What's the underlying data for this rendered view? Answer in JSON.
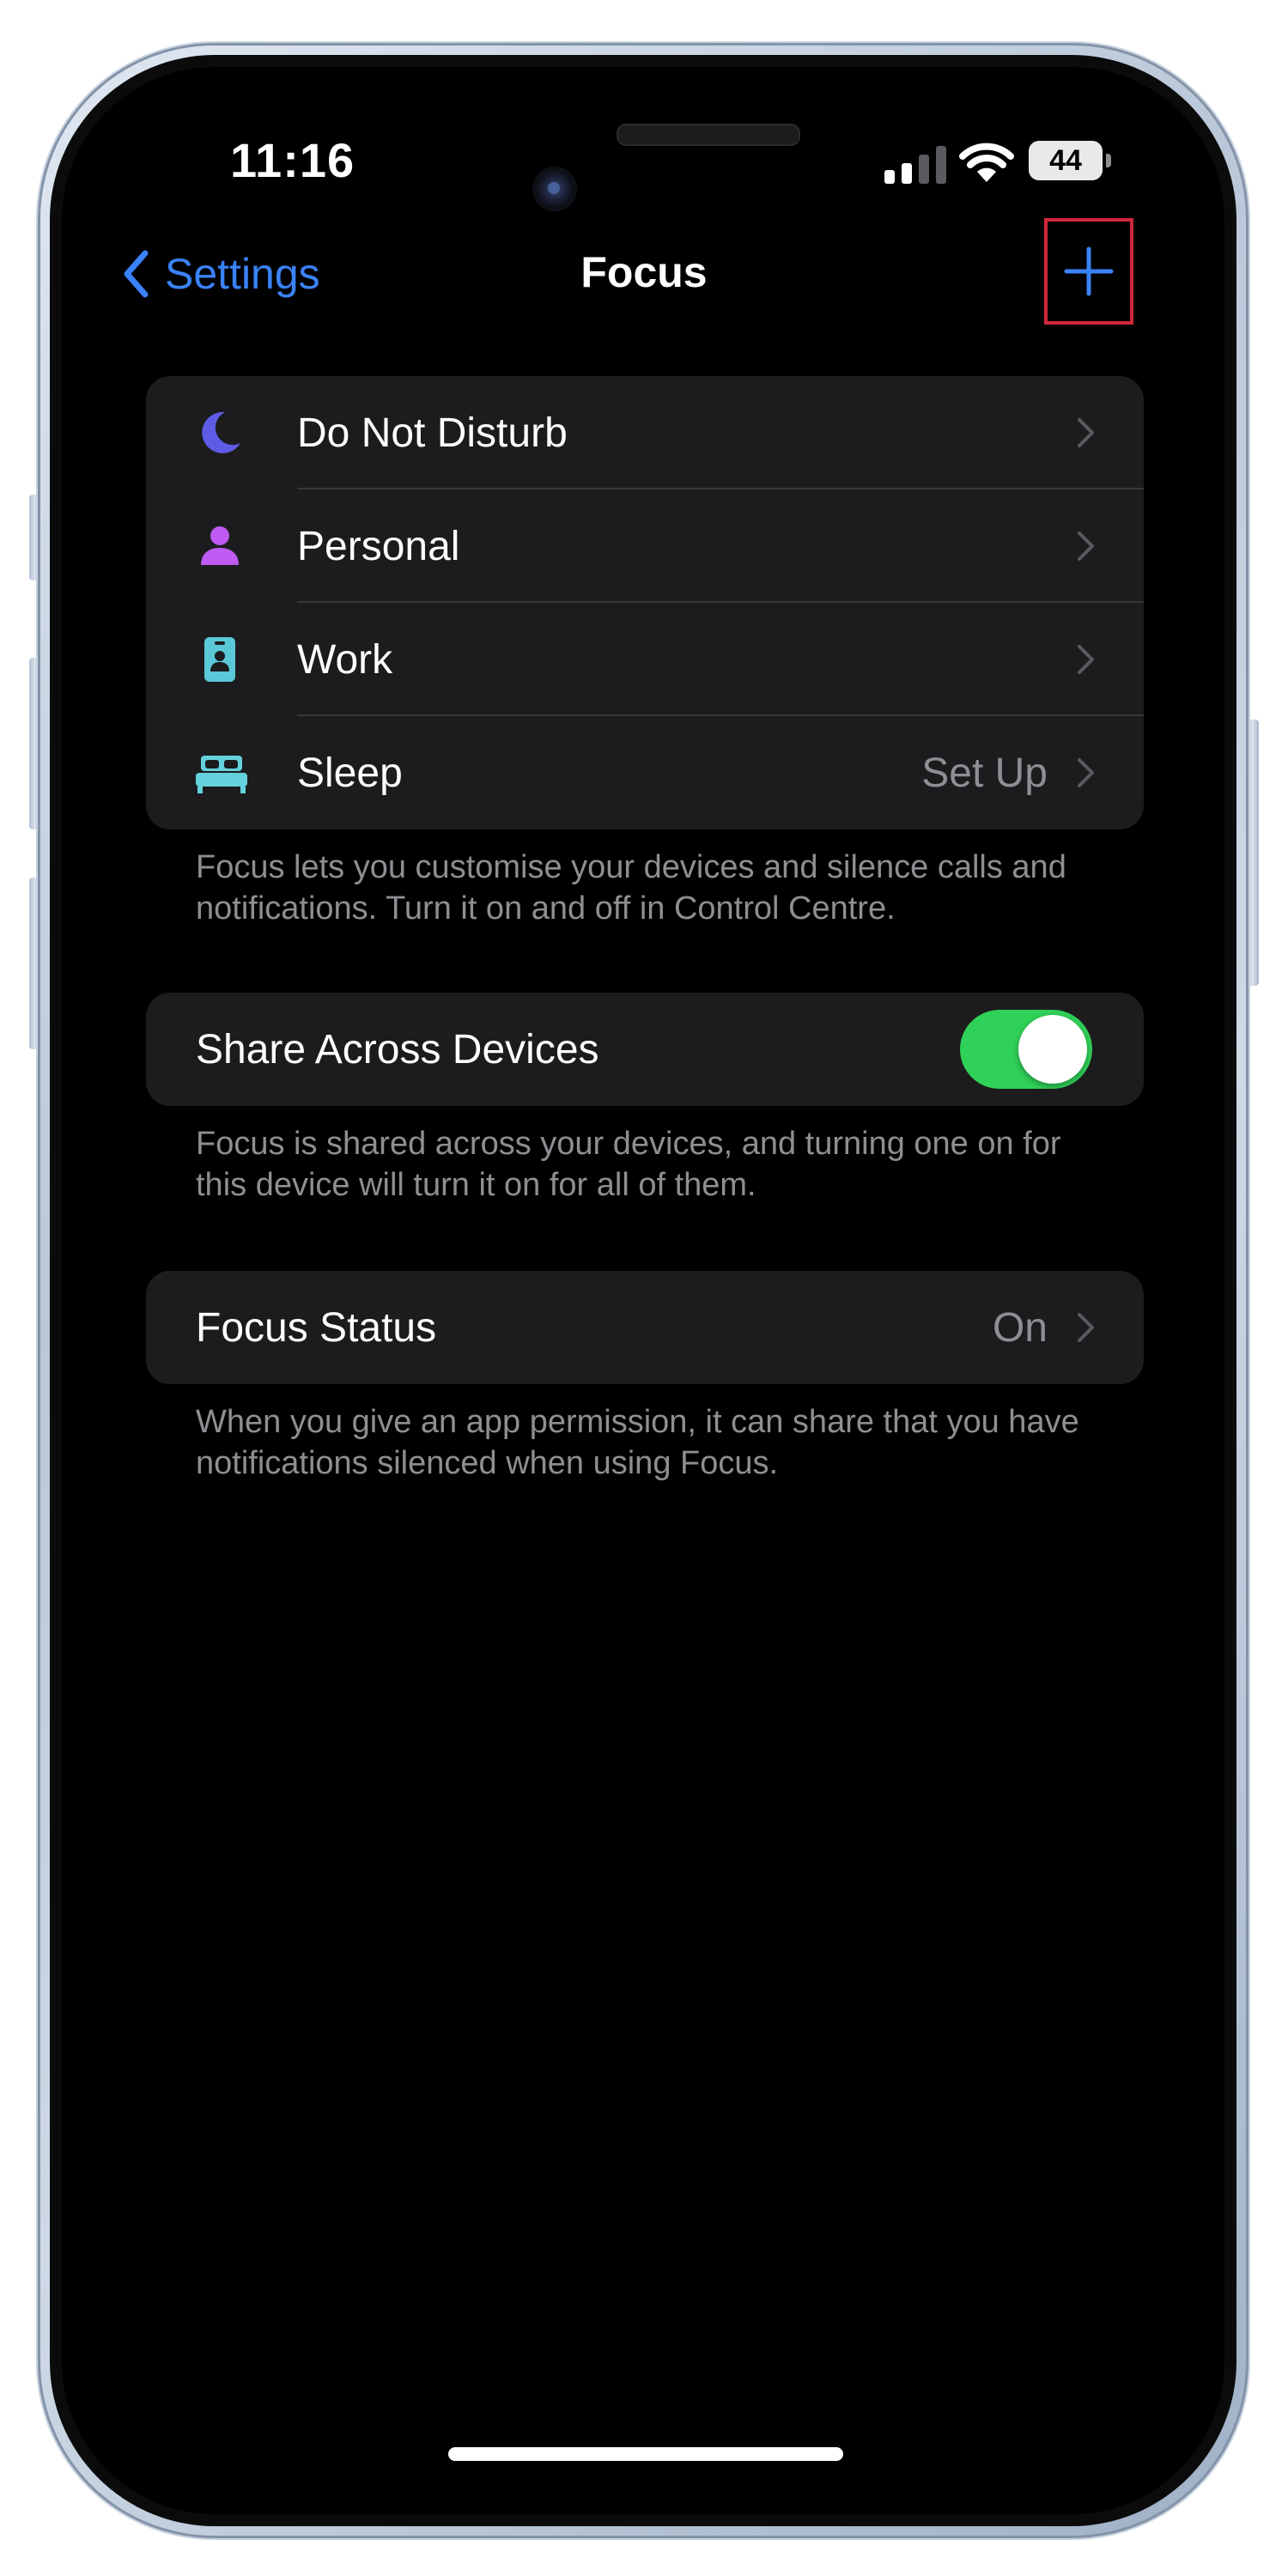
{
  "status_bar": {
    "time": "11:16",
    "battery_level": "44",
    "signal_bars_active": 2,
    "signal_bars_total": 4
  },
  "nav": {
    "back_label": "Settings",
    "title": "Focus",
    "add_icon": "plus-icon",
    "back_icon": "chevron-left-icon"
  },
  "focus_modes": [
    {
      "label": "Do Not Disturb",
      "icon": "moon-icon",
      "color": "#5e5ce6",
      "value": ""
    },
    {
      "label": "Personal",
      "icon": "person-icon",
      "color": "#bf5af2",
      "value": ""
    },
    {
      "label": "Work",
      "icon": "id-badge-icon",
      "color": "#5ac8d8",
      "value": ""
    },
    {
      "label": "Sleep",
      "icon": "bed-icon",
      "color": "#64d2dd",
      "value": "Set Up"
    }
  ],
  "focus_footnote": "Focus lets you customise your devices and silence calls and notifications. Turn it on and off in Control Centre.",
  "share": {
    "label": "Share Across Devices",
    "enabled": true,
    "footnote": "Focus is shared across your devices, and turning one on for this device will turn it on for all of them."
  },
  "status": {
    "label": "Focus Status",
    "value": "On",
    "footnote": "When you give an app permission, it can share that you have notifications silenced when using Focus."
  },
  "colors": {
    "accent_blue": "#3a82f7",
    "toggle_green": "#30d158",
    "highlight_red": "#d0273a",
    "background": "#000000",
    "cell": "#1c1c1e",
    "secondary_text": "#8e8e93"
  }
}
